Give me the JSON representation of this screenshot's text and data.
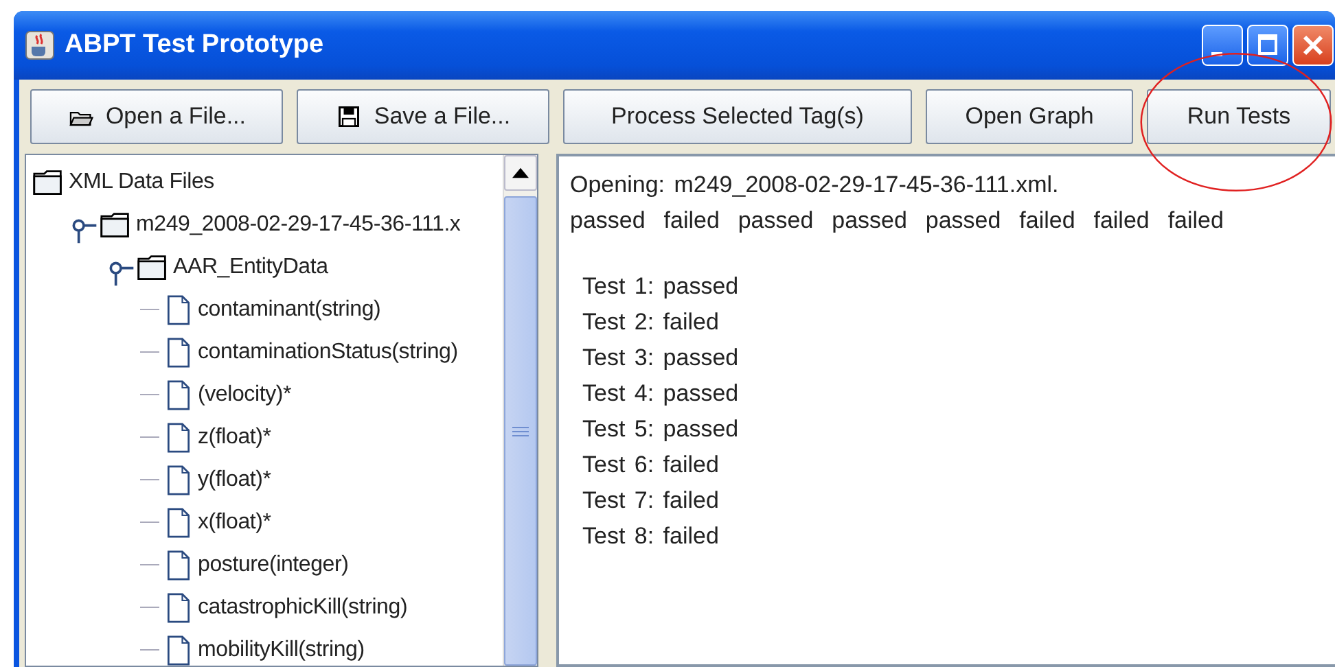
{
  "window": {
    "title": "ABPT Test Prototype"
  },
  "toolbar": [
    {
      "label": "Open a File...",
      "kind": "open"
    },
    {
      "label": "Save a File...",
      "kind": "save"
    },
    {
      "label": "Process Selected Tag(s)",
      "kind": "plain"
    },
    {
      "label": "Open Graph",
      "kind": "plain"
    },
    {
      "label": "Run Tests",
      "kind": "plain"
    }
  ],
  "tree": {
    "label": "XML Data Files",
    "kind": "folder",
    "children": [
      {
        "label": "m249_2008-02-29-17-45-36-111.x",
        "kind": "folder",
        "expanded": true,
        "children": [
          {
            "label": "AAR_EntityData",
            "kind": "folder",
            "expanded": true,
            "children": [
              {
                "label": "contaminant(string)",
                "kind": "leaf"
              },
              {
                "label": "contaminationStatus(string)",
                "kind": "leaf"
              },
              {
                "label": "(velocity)*",
                "kind": "leaf"
              },
              {
                "label": "z(float)*",
                "kind": "leaf"
              },
              {
                "label": "y(float)*",
                "kind": "leaf"
              },
              {
                "label": "x(float)*",
                "kind": "leaf"
              },
              {
                "label": "posture(integer)",
                "kind": "leaf"
              },
              {
                "label": "catastrophicKill(string)",
                "kind": "leaf"
              },
              {
                "label": "mobilityKill(string)",
                "kind": "leaf"
              }
            ]
          }
        ]
      }
    ]
  },
  "output": {
    "header_lines": [
      "Opening: m249_2008-02-29-17-45-36-111.xml.",
      "passed  failed  passed  passed  passed  failed  failed  failed"
    ],
    "results": [
      "Test 1: passed",
      "Test 2: failed",
      "Test 3: passed",
      "Test 4: passed",
      "Test 5: passed",
      "Test 6: failed",
      "Test 7: failed",
      "Test 8: failed"
    ]
  }
}
